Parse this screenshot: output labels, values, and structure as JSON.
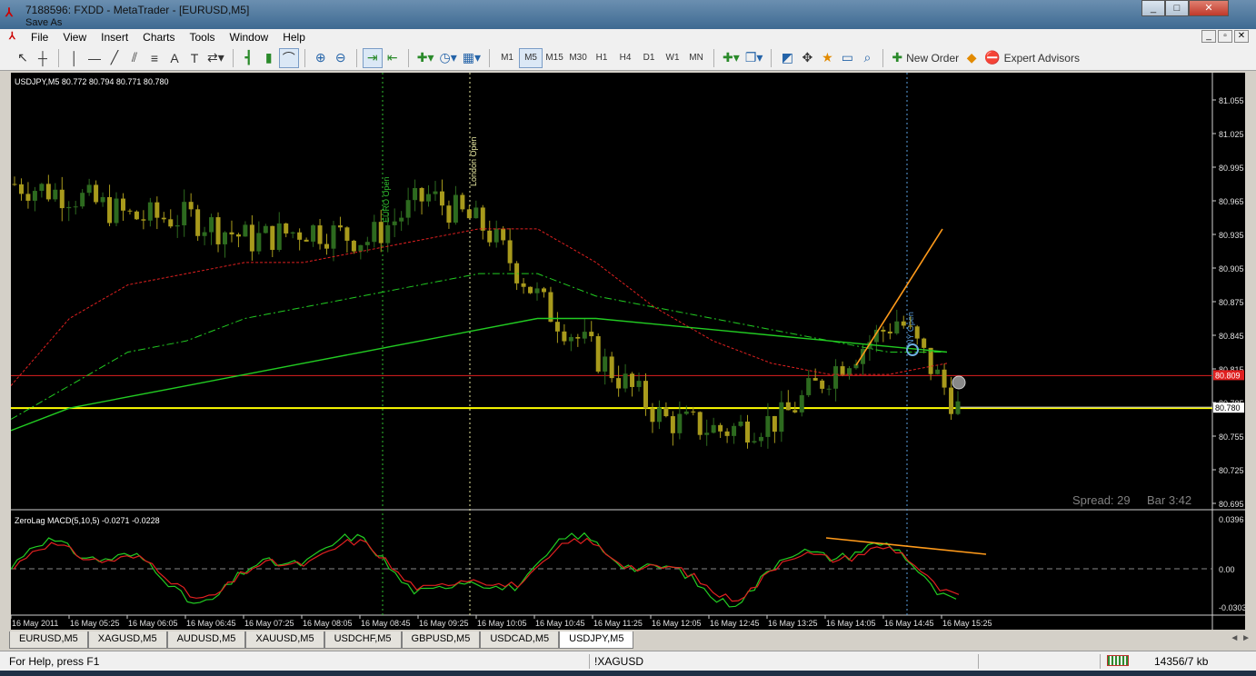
{
  "window": {
    "title": "7188596: FXDD - MetaTrader - [EURUSD,M5]",
    "subtitle": "Save As",
    "controls": [
      "_",
      "□",
      "✕"
    ]
  },
  "menu": [
    "File",
    "View",
    "Insert",
    "Charts",
    "Tools",
    "Window",
    "Help"
  ],
  "toolbar": {
    "timeframes": [
      "M1",
      "M5",
      "M15",
      "M30",
      "H1",
      "H4",
      "D1",
      "W1",
      "MN"
    ],
    "active_timeframe": "M5",
    "new_order_label": "New Order",
    "expert_advisors_label": "Expert Advisors"
  },
  "chart": {
    "header": "USDJPY,M5  80.772 80.794 80.771 80.780",
    "spread": "Spread: 29",
    "bar_timer": "Bar  3:42",
    "markers": [
      "EURO Open",
      "London Open",
      "NY Open"
    ],
    "price_labels": [
      "81.055",
      "81.025",
      "80.995",
      "80.965",
      "80.935",
      "80.905",
      "80.875",
      "80.845",
      "80.815",
      "80.785",
      "80.755",
      "80.725",
      "80.695"
    ],
    "red_line_label": "80.809",
    "current_price_label": "80.780",
    "macd_header": "ZeroLag MACD(5,10,5) -0.0271 -0.0228",
    "macd_labels": [
      "0.0396",
      "0.00",
      "-0.0303"
    ],
    "time_labels": [
      "16 May 2011",
      "16 May 05:25",
      "16 May 06:05",
      "16 May 06:45",
      "16 May 07:25",
      "16 May 08:05",
      "16 May 08:45",
      "16 May 09:25",
      "16 May 10:05",
      "16 May 10:45",
      "16 May 11:25",
      "16 May 12:05",
      "16 May 12:45",
      "16 May 13:25",
      "16 May 14:05",
      "16 May 14:45",
      "16 May 15:25"
    ],
    "colors": {
      "bull": "#2d6a1f",
      "bear": "#a89a1c",
      "yellow_line": "#ffff00",
      "red_line": "#e02020",
      "green_ma": "#22cc22"
    }
  },
  "chart_data": {
    "type": "line",
    "title": "USDJPY,M5",
    "ylim": [
      80.695,
      81.055
    ],
    "x": [
      "16 May 2011",
      "16 May 05:25",
      "16 May 06:05",
      "16 May 06:45",
      "16 May 07:25",
      "16 May 08:05",
      "16 May 08:45",
      "16 May 09:25",
      "16 May 10:05",
      "16 May 10:45",
      "16 May 11:25",
      "16 May 12:05",
      "16 May 12:45",
      "16 May 13:25",
      "16 May 14:05",
      "16 May 14:45",
      "16 May 15:25"
    ],
    "series": [
      {
        "values": [
          80.98,
          80.97,
          80.95,
          80.95,
          80.93,
          80.94,
          80.93,
          80.97,
          80.94,
          80.87,
          80.82,
          80.77,
          80.76,
          80.77,
          80.82,
          80.86,
          80.78
        ]
      },
      {
        "values": [
          80.8,
          80.86,
          80.89,
          80.9,
          80.91,
          80.91,
          80.92,
          80.93,
          80.94,
          80.94,
          80.91,
          80.87,
          80.84,
          80.82,
          80.81,
          80.81,
          80.82
        ]
      },
      {
        "values": [
          80.77,
          80.8,
          80.83,
          80.84,
          80.86,
          80.87,
          80.88,
          80.89,
          80.9,
          80.9,
          80.88,
          80.87,
          80.86,
          80.85,
          80.84,
          80.83,
          80.83
        ]
      },
      {
        "values": [
          80.76,
          80.78,
          80.79,
          80.8,
          80.81,
          80.82,
          80.83,
          80.84,
          80.85,
          80.86,
          80.86,
          80.855,
          80.85,
          80.845,
          80.84,
          80.835,
          80.83
        ]
      }
    ]
  },
  "tabs": [
    "EURUSD,M5",
    "XAGUSD,M5",
    "AUDUSD,M5",
    "XAUUSD,M5",
    "USDCHF,M5",
    "GBPUSD,M5",
    "USDCAD,M5",
    "USDJPY,M5"
  ],
  "active_tab": "USDJPY,M5",
  "status": {
    "help": "For Help, press F1",
    "profile": "!XAGUSD",
    "connection": "14356/7 kb"
  }
}
